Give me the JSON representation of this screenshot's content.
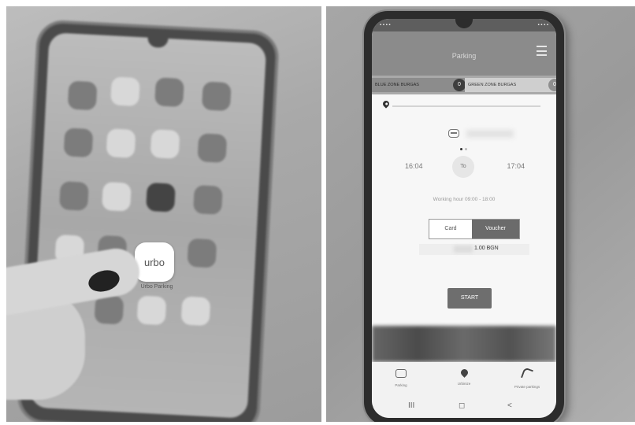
{
  "left_photo": {
    "app_icon_text": "urbo",
    "app_icon_label": "Urbo Parking"
  },
  "app": {
    "title": "Parking",
    "zones": [
      {
        "label": "BLUE ZONE BURGAS",
        "count": "0"
      },
      {
        "label": "GREEN ZONE BURGAS",
        "count": "0"
      }
    ],
    "time_from": "16:04",
    "time_to_label": "To",
    "time_to": "17:04",
    "working_hours": "Working hour 09:00 - 18:00",
    "payment_options": [
      "Card",
      "Voucher"
    ],
    "price": "1.00 BGN",
    "start_label": "START",
    "nav": [
      {
        "label": "Parking",
        "icon": "car-icon"
      },
      {
        "label": "Urbinize",
        "icon": "location-pin-icon"
      },
      {
        "label": "Private parkings",
        "icon": "key-icon"
      }
    ],
    "system_nav": [
      "III",
      "◻",
      "<"
    ]
  }
}
